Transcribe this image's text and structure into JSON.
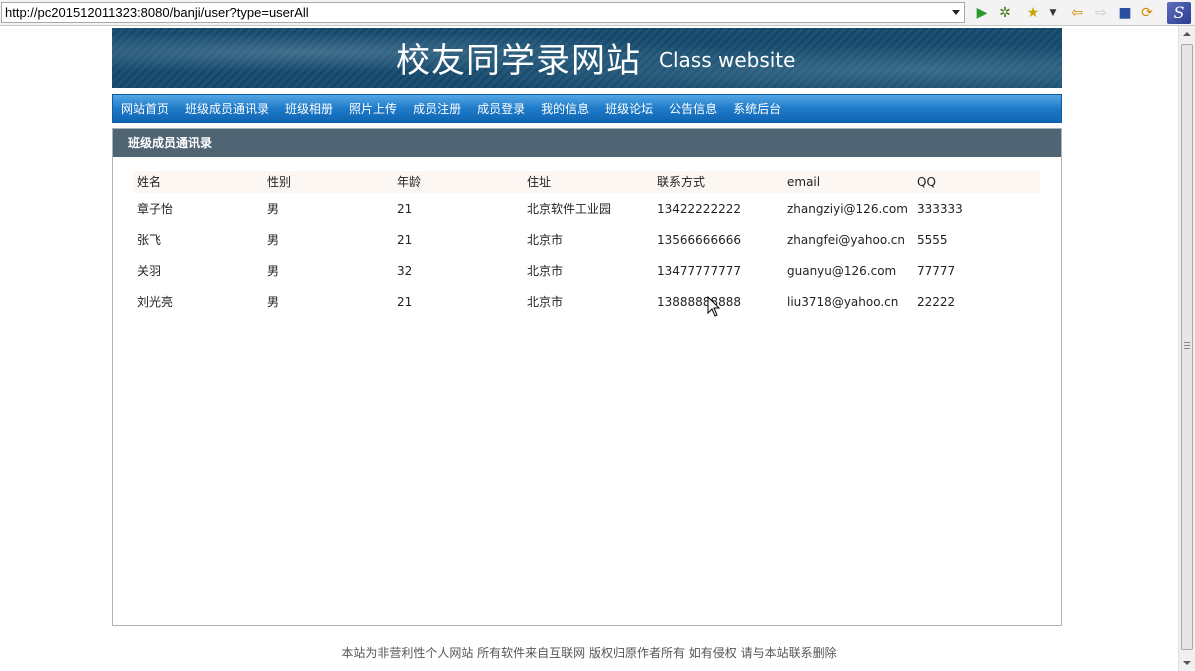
{
  "browser": {
    "url": "http://pc201512011323:8080/banji/user?type=userAll",
    "logo_letter": "S"
  },
  "banner": {
    "title_cn": "校友同学录网站",
    "title_en": "Class website"
  },
  "nav": {
    "items": [
      "网站首页",
      "班级成员通讯录",
      "班级相册",
      "照片上传",
      "成员注册",
      "成员登录",
      "我的信息",
      "班级论坛",
      "公告信息",
      "系统后台"
    ]
  },
  "section": {
    "title": "班级成员通讯录"
  },
  "table": {
    "headers": [
      "姓名",
      "性别",
      "年龄",
      "住址",
      "联系方式",
      "email",
      "QQ"
    ],
    "rows": [
      [
        "章子怡",
        "男",
        "21",
        "北京软件工业园",
        "13422222222",
        "zhangziyi@126.com",
        "333333"
      ],
      [
        "张飞",
        "男",
        "21",
        "北京市",
        "13566666666",
        "zhangfei@yahoo.cn",
        "5555"
      ],
      [
        "关羽",
        "男",
        "32",
        "北京市",
        "13477777777",
        "guanyu@126.com",
        "77777"
      ],
      [
        "刘光亮",
        "男",
        "21",
        "北京市",
        "13888888888",
        "liu3718@yahoo.cn",
        "22222"
      ]
    ]
  },
  "footer": {
    "text": "本站为非营利性个人网站  所有软件来自互联网  版权归原作者所有  如有侵权  请与本站联系删除"
  },
  "colors": {
    "nav_blue": "#1e7ac8",
    "section_header": "#4f6573",
    "table_header_bg": "#fcf7f2"
  }
}
